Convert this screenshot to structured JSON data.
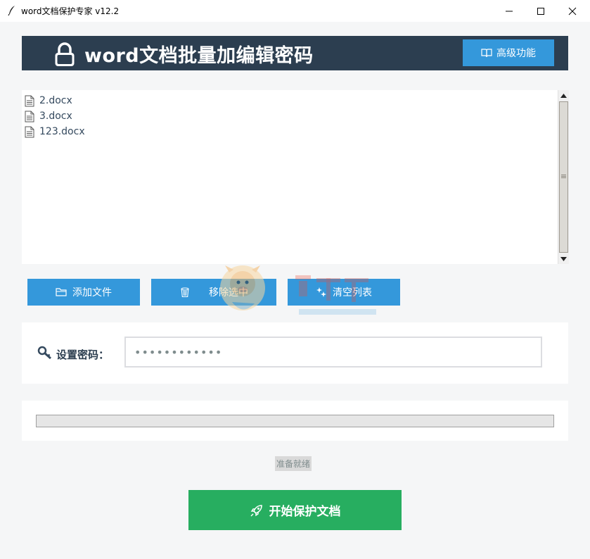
{
  "window": {
    "title": "word文档保护专家 v12.2",
    "icon": "feather-icon"
  },
  "header": {
    "title": "word文档批量加编辑密码",
    "advanced_label": "高级功能",
    "lock_icon": "lock-icon",
    "background": "#2c3e50"
  },
  "files": [
    {
      "name": "2.docx"
    },
    {
      "name": "3.docx"
    },
    {
      "name": "123.docx"
    }
  ],
  "buttons": {
    "add_files": "添加文件",
    "remove_selected": "移除选中",
    "clear_list": "清空列表",
    "start": "开始保护文档"
  },
  "password": {
    "label": "设置密码：",
    "value": "************"
  },
  "progress": {
    "value": 0
  },
  "status": "准备就绪",
  "colors": {
    "accent": "#3498db",
    "start": "#27ae60",
    "header": "#2c3e50"
  }
}
